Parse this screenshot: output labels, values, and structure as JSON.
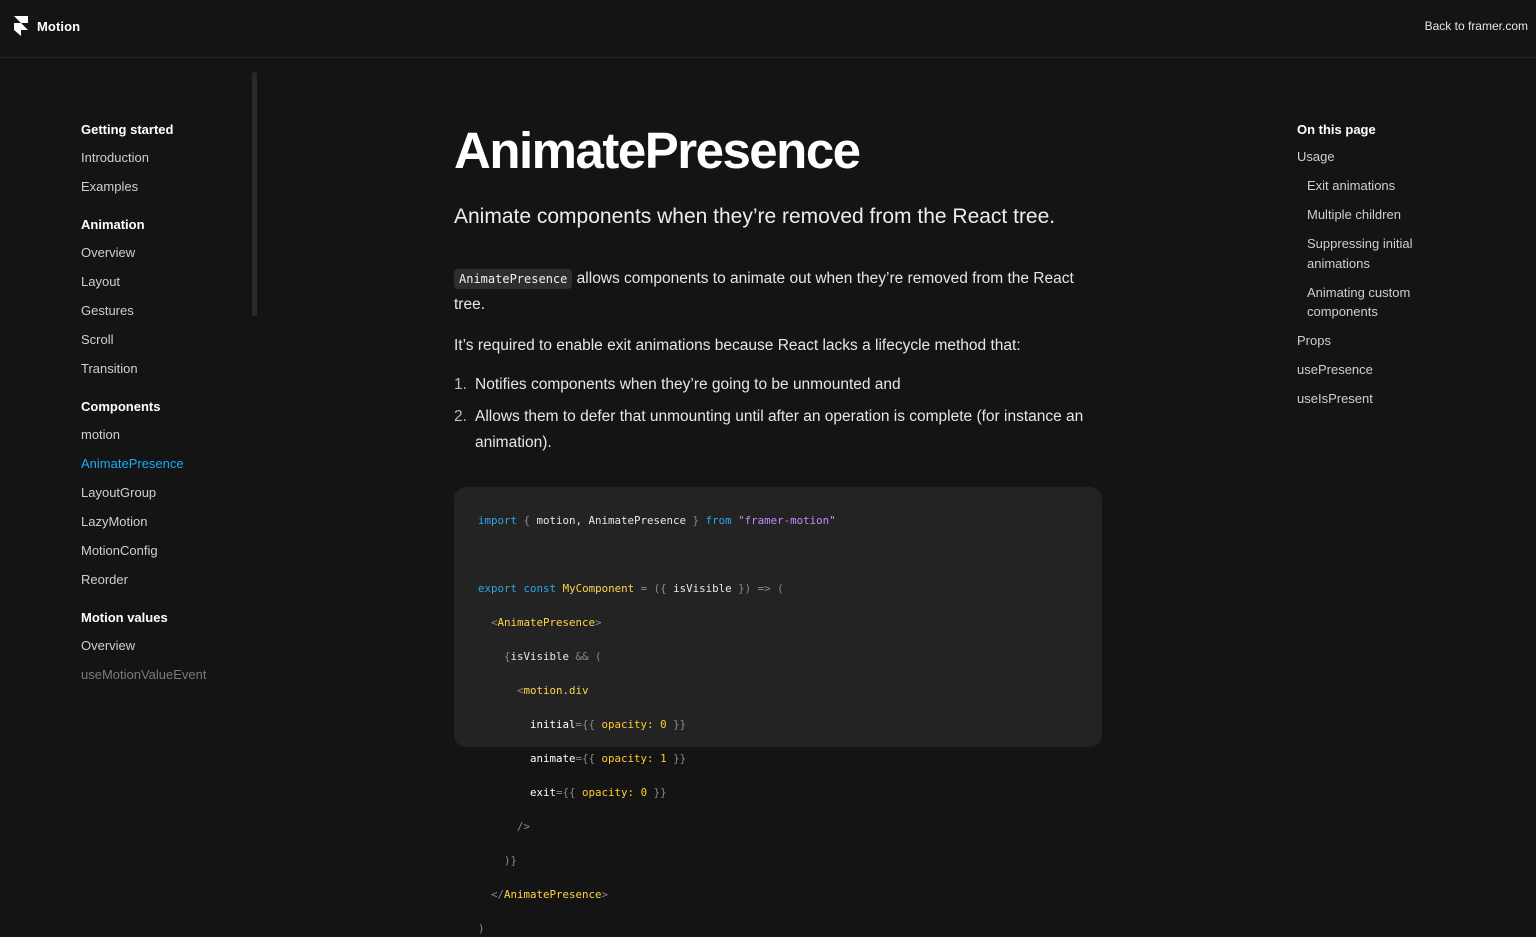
{
  "header": {
    "brand": "Motion",
    "back_link": "Back to framer.com"
  },
  "sidebar": {
    "groups": [
      {
        "heading": "Getting started",
        "items": [
          "Introduction",
          "Examples"
        ]
      },
      {
        "heading": "Animation",
        "items": [
          "Overview",
          "Layout",
          "Gestures",
          "Scroll",
          "Transition"
        ]
      },
      {
        "heading": "Components",
        "items": [
          "motion",
          "AnimatePresence",
          "LayoutGroup",
          "LazyMotion",
          "MotionConfig",
          "Reorder"
        ]
      },
      {
        "heading": "Motion values",
        "items": [
          "Overview",
          "useMotionValueEvent"
        ]
      }
    ],
    "active_item": "AnimatePresence"
  },
  "main": {
    "title": "AnimatePresence",
    "subtitle": "Animate components when they’re removed from the React tree.",
    "p1_code": "AnimatePresence",
    "p1_text": " allows components to animate out when they’re removed from the React tree.",
    "p2": "It’s required to enable exit animations because React lacks a lifecycle method that:",
    "steps": [
      {
        "num": "1.",
        "text": "Notifies components when they’re going to be unmounted and"
      },
      {
        "num": "2.",
        "text": "Allows them to defer that unmounting until after an operation is complete (for instance an animation)."
      }
    ]
  },
  "code": {
    "l1_import": "import",
    "l1_open": " { ",
    "l1_names": "motion, AnimatePresence",
    "l1_close": " } ",
    "l1_from": "from",
    "l1_str": "\"framer-motion\"",
    "l3_export": "export",
    "l3_const": "const",
    "l3_name": "MyComponent",
    "l3_eq": " = ({ ",
    "l3_param": "isVisible",
    "l3_arrow": " }) => (",
    "l4_open": "<",
    "l4_tag": "AnimatePresence",
    "l4_close": ">",
    "l5_brace": "{",
    "l5_var": "isVisible",
    "l5_and": " && (",
    "l6_open": "<",
    "l6_tag": "motion.div",
    "l7_attr": "initial",
    "l7_eq": "={{ ",
    "l7_key": "opacity:",
    "l7_val": " 0",
    "l7_end": " }}",
    "l8_attr": "animate",
    "l8_eq": "={{ ",
    "l8_key": "opacity:",
    "l8_val": " 1",
    "l8_end": " }}",
    "l9_attr": "exit",
    "l9_eq": "={{ ",
    "l9_key": "opacity:",
    "l9_val": " 0",
    "l9_end": " }}",
    "l10": "/>",
    "l11": ")}",
    "l12_open": "</",
    "l12_tag": "AnimatePresence",
    "l12_close": ">",
    "l13": ")"
  },
  "toc": {
    "heading": "On this page",
    "items": [
      {
        "label": "Usage",
        "sub": false
      },
      {
        "label": "Exit animations",
        "sub": true
      },
      {
        "label": "Multiple children",
        "sub": true
      },
      {
        "label": "Suppressing initial animations",
        "sub": true
      },
      {
        "label": "Animating custom components",
        "sub": true
      },
      {
        "label": "Props",
        "sub": false
      },
      {
        "label": "usePresence",
        "sub": false
      },
      {
        "label": "useIsPresent",
        "sub": false
      }
    ]
  },
  "colors": {
    "background": "#141414",
    "active_link": "#1aa9f5",
    "code_background": "#232323"
  }
}
